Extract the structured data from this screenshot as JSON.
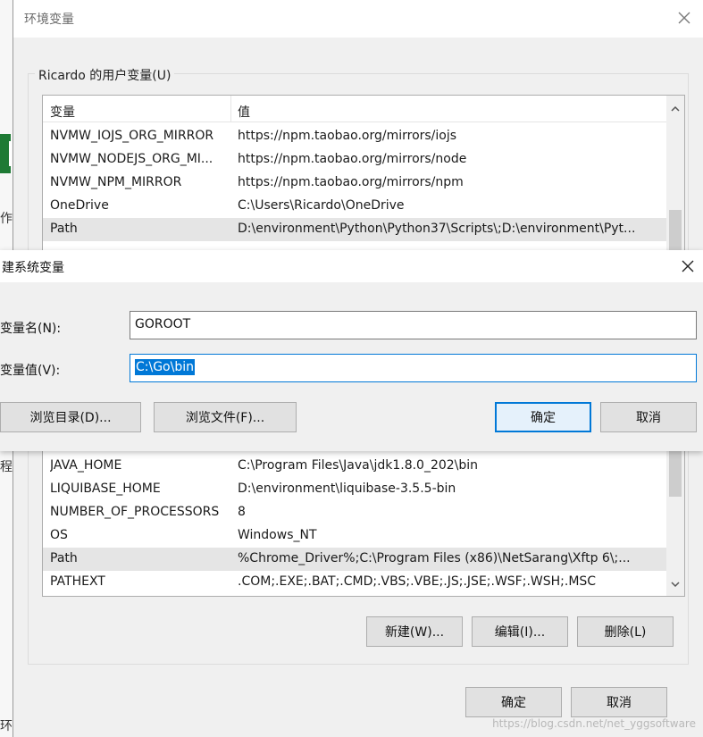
{
  "background_app": {
    "fragments": [
      "作",
      "程",
      "环"
    ]
  },
  "env_window": {
    "title": "环境变量",
    "user_section_label": "Ricardo 的用户变量(U)",
    "columns": [
      "变量",
      "值"
    ],
    "user_vars": [
      {
        "name": "NVMW_IOJS_ORG_MIRROR",
        "value": "https://npm.taobao.org/mirrors/iojs"
      },
      {
        "name": "NVMW_NODEJS_ORG_MI...",
        "value": "https://npm.taobao.org/mirrors/node"
      },
      {
        "name": "NVMW_NPM_MIRROR",
        "value": "https://npm.taobao.org/mirrors/npm"
      },
      {
        "name": "OneDrive",
        "value": "C:\\Users\\Ricardo\\OneDrive"
      },
      {
        "name": "Path",
        "value": "D:\\environment\\Python\\Python37\\Scripts\\;D:\\environment\\Pyt..."
      }
    ],
    "system_vars": [
      {
        "name": "JAVA_HOME",
        "value": "C:\\Program Files\\Java\\jdk1.8.0_202\\bin"
      },
      {
        "name": "LIQUIBASE_HOME",
        "value": "D:\\environment\\liquibase-3.5.5-bin"
      },
      {
        "name": "NUMBER_OF_PROCESSORS",
        "value": "8"
      },
      {
        "name": "OS",
        "value": "Windows_NT"
      },
      {
        "name": "Path",
        "value": "%Chrome_Driver%;C:\\Program Files (x86)\\NetSarang\\Xftp 6\\;..."
      },
      {
        "name": "PATHEXT",
        "value": ".COM;.EXE;.BAT;.CMD;.VBS;.VBE;.JS;.JSE;.WSF;.WSH;.MSC"
      }
    ],
    "buttons": {
      "new": "新建(W)...",
      "edit": "编辑(I)...",
      "delete": "删除(L)",
      "ok": "确定",
      "cancel": "取消"
    }
  },
  "new_var_dialog": {
    "title": "建系统变量",
    "name_label": "变量名(N):",
    "name_value": "GOROOT",
    "value_label": "变量值(V):",
    "value_value": "C:\\Go\\bin",
    "buttons": {
      "browse_dir": "浏览目录(D)...",
      "browse_file": "浏览文件(F)...",
      "ok": "确定",
      "cancel": "取消"
    }
  },
  "watermark": "https://blog.csdn.net/net_yggsoftware",
  "colors": {
    "accent": "#0078d7",
    "selected_row": "#e5e5e5",
    "dialog_bg": "#f0f0f0"
  }
}
